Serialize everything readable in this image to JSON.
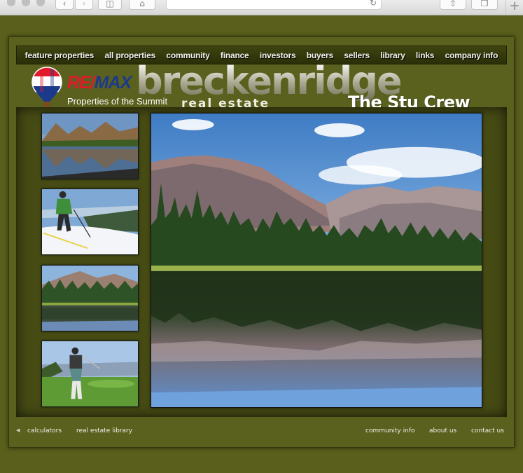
{
  "browser": {
    "back_icon": "chevron-left-icon",
    "forward_icon": "chevron-right-icon",
    "sidebar_icon": "sidebar-icon",
    "home_icon": "home-icon",
    "reload_icon": "reload-icon",
    "share_icon": "share-icon",
    "tabs_icon": "tabs-icon",
    "new_tab_icon": "plus-icon"
  },
  "nav": {
    "items": [
      {
        "label": "feature properties"
      },
      {
        "label": "all properties"
      },
      {
        "label": "community"
      },
      {
        "label": "finance"
      },
      {
        "label": "investors"
      },
      {
        "label": "buyers"
      },
      {
        "label": "sellers"
      },
      {
        "label": "library"
      },
      {
        "label": "links"
      },
      {
        "label": "company info"
      }
    ]
  },
  "header": {
    "remax_re": "RE",
    "remax_slash": "/",
    "remax_max": "MAX",
    "tagline": "Properties of the Summit",
    "brand": "breckenridge",
    "subbrand": "real estate",
    "crew": "The Stu Crew"
  },
  "footer": {
    "left_links": [
      {
        "label": "calculators"
      },
      {
        "label": "real estate library"
      }
    ],
    "right_links": [
      {
        "label": "community info"
      },
      {
        "label": "about us"
      },
      {
        "label": "contact us"
      }
    ]
  },
  "colors": {
    "page_bg": "#5a5f1c",
    "nav_bg": "#33370c",
    "remax_red": "#e01a2b",
    "remax_blue": "#1b3a8c"
  }
}
